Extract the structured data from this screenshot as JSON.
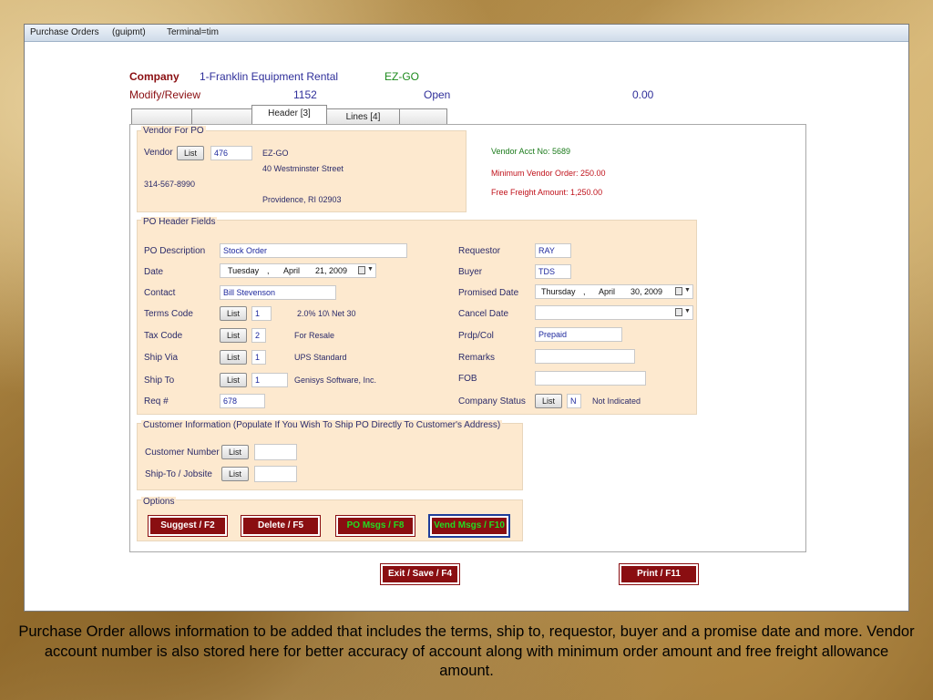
{
  "titlebar": {
    "app": "Purchase Orders",
    "program": "(guipmt)",
    "terminal": "Terminal=tim"
  },
  "header": {
    "company_label": "Company",
    "company_value": "1-Franklin Equipment Rental",
    "vendor_short": "EZ-GO",
    "mode": "Modify/Review",
    "po_number": "1152",
    "status": "Open",
    "amount": "0.00"
  },
  "tabs": [
    {
      "label": ""
    },
    {
      "label": ""
    },
    {
      "label": "Header [3]",
      "active": true
    },
    {
      "label": "Lines [4]"
    },
    {
      "label": ""
    }
  ],
  "vendor": {
    "group_title": "Vendor For PO",
    "vendor_label": "Vendor",
    "list_label": "List",
    "vendor_number": "476",
    "name": "EZ-GO",
    "street": "40 Westminster Street",
    "phone": "314-567-8990",
    "city_state_zip": "Providence, RI 02903",
    "acct_no": "Vendor Acct No: 5689",
    "min_order": "Minimum Vendor Order:   250.00",
    "free_freight": "Free Freight Amount:  1,250.00"
  },
  "po_header": {
    "group_title": "PO Header Fields",
    "description_label": "PO Description",
    "description_value": "Stock Order",
    "date_label": "Date",
    "date": {
      "weekday": "Tuesday",
      "sep": ",",
      "month": "April",
      "day_year": "21, 2009"
    },
    "contact_label": "Contact",
    "contact_value": "Bill Stevenson",
    "terms_label": "Terms Code",
    "terms_code": "1",
    "terms_desc": "2.0% 10\\ Net 30",
    "tax_label": "Tax Code",
    "tax_code": "2",
    "tax_desc": "For Resale",
    "shipvia_label": "Ship Via",
    "shipvia_code": "1",
    "shipvia_desc": "UPS Standard",
    "shipto_label": "Ship To",
    "shipto_code": "1",
    "shipto_desc": "Genisys Software, Inc.",
    "req_label": "Req #",
    "req_value": "678",
    "requestor_label": "Requestor",
    "requestor_value": "RAY",
    "buyer_label": "Buyer",
    "buyer_value": "TDS",
    "promised_label": "Promised Date",
    "promised_date": {
      "weekday": "Thursday",
      "sep": ",",
      "month": "April",
      "day_year": "30, 2009"
    },
    "cancel_label": "Cancel Date",
    "cancel_value": "",
    "prdp_label": "Prdp/Col",
    "prdp_value": "Prepaid",
    "remarks_label": "Remarks",
    "remarks_value": "",
    "fob_label": "FOB",
    "fob_value": "",
    "company_status_label": "Company Status",
    "company_status_code": "N",
    "company_status_desc": "Not Indicated",
    "list_label": "List"
  },
  "customer": {
    "group_title": "Customer Information (Populate If You Wish To Ship PO Directly To Customer's Address)",
    "number_label": "Customer Number",
    "number_value": "",
    "shipto_label": "Ship-To / Jobsite",
    "shipto_value": "",
    "list_label": "List"
  },
  "options": {
    "group_title": "Options",
    "suggest": "Suggest / F2",
    "delete": "Delete / F5",
    "po_msgs": "PO Msgs / F8",
    "vend_msgs": "Vend Msgs / F10"
  },
  "footer": {
    "exit_save": "Exit / Save / F4",
    "print": "Print / F11"
  },
  "caption": "Purchase Order allows information to be added that includes the terms, ship to, requestor, buyer and a promise date and more. Vendor account number is also stored here for better accuracy of account along with minimum order amount and free freight allowance amount.",
  "colors": {
    "accent_red": "#8a0e11",
    "group_bg": "#fde9cf",
    "link_blue": "#1f2a9e",
    "green_text": "#00c000"
  }
}
